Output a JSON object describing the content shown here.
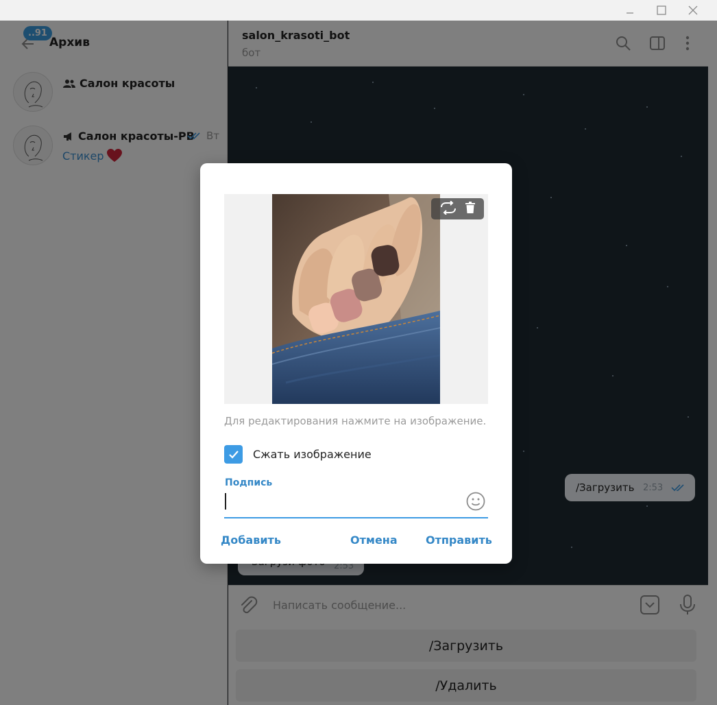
{
  "sidebar": {
    "badge": "..91",
    "title": "Архив",
    "chats": [
      {
        "name": "Салон красоты",
        "type_icon": "group-icon"
      },
      {
        "name": "Салон красоты-РВ",
        "type_icon": "megaphone-icon",
        "time": "Вт",
        "preview": "Стикер",
        "preview_emoji": "heart-icon"
      }
    ]
  },
  "header": {
    "name": "salon_krasoti_bot",
    "status": "бот",
    "icons": [
      "search-icon",
      "sidebar-toggle-icon",
      "more-vertical-icon"
    ]
  },
  "messages": [
    {
      "text": "/Загрузить",
      "time": "2:53",
      "direction": "outgoing",
      "read_icon": "double-check-icon"
    },
    {
      "text": "Загрузи фото",
      "time": "2:53",
      "direction": "incoming"
    }
  ],
  "composer": {
    "placeholder": "Написать сообщение..."
  },
  "keyboard": {
    "buttons": [
      "/Загрузить",
      "/Удалить"
    ]
  },
  "dialog": {
    "hint": "Для редактирования нажмите на изображение.",
    "compress": {
      "label": "Сжать изображение",
      "checked": true
    },
    "caption": {
      "label": "Подпись",
      "value": ""
    },
    "buttons": {
      "add": "Добавить",
      "cancel": "Отмена",
      "send": "Отправить"
    }
  },
  "colors": {
    "accent": "#3d9be4",
    "link": "#3588c7",
    "chat_background": "#1f2a33"
  }
}
